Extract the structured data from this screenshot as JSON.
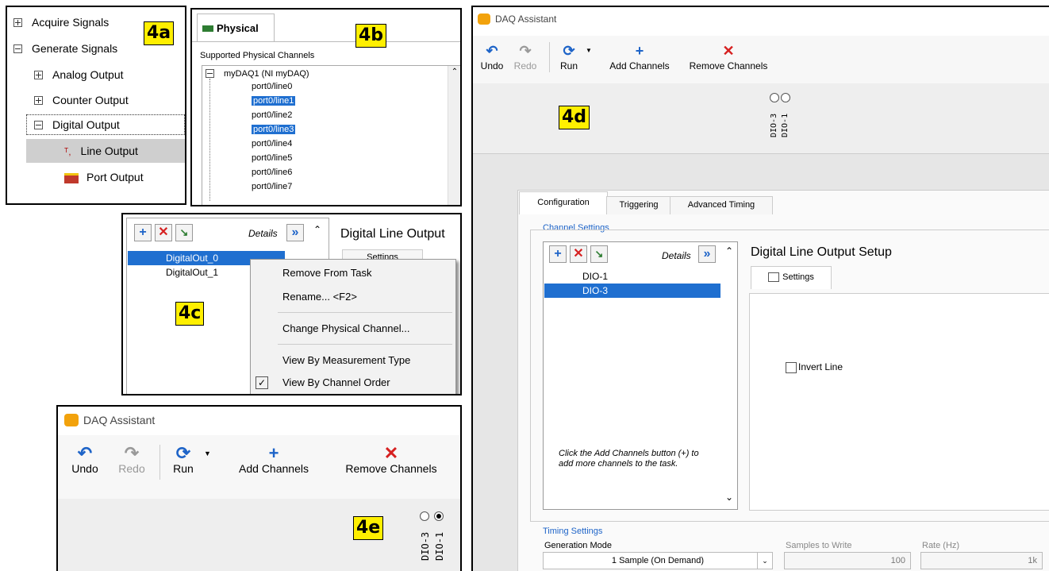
{
  "panel_4a": {
    "tag": "4a",
    "rows": [
      {
        "label": "Acquire Signals",
        "expander": "plus"
      },
      {
        "label": "Generate Signals",
        "expander": "minus"
      },
      {
        "label": "Analog Output",
        "expander": "plus"
      },
      {
        "label": "Counter Output",
        "expander": "plus"
      },
      {
        "label": "Digital Output",
        "expander": "minus"
      },
      {
        "label": "Line Output",
        "icon": "line-output-icon"
      },
      {
        "label": "Port Output",
        "icon": "port-output-icon"
      }
    ]
  },
  "panel_4b": {
    "tag": "4b",
    "tab_label": "Physical",
    "section_label": "Supported Physical Channels",
    "device": "myDAQ1  (NI myDAQ)",
    "channels": [
      "port0/line0",
      "port0/line1",
      "port0/line2",
      "port0/line3",
      "port0/line4",
      "port0/line5",
      "port0/line6",
      "port0/line7"
    ],
    "selected": [
      "port0/line1",
      "port0/line3"
    ]
  },
  "panel_4c": {
    "tag": "4c",
    "details_label": "Details",
    "heading": "Digital Line Output",
    "settings_tab": "Settings",
    "channels": [
      "DigitalOut_0",
      "DigitalOut_1"
    ],
    "context_menu": [
      "Remove From Task",
      "Rename... <F2>",
      "Change Physical Channel...",
      "View By Measurement Type",
      "View By Channel Order"
    ]
  },
  "panel_4d": {
    "tag": "4d",
    "window_title": "DAQ Assistant",
    "toolbar": {
      "undo": "Undo",
      "redo": "Redo",
      "run": "Run",
      "add": "Add Channels",
      "remove": "Remove Channels"
    },
    "leds": [
      "DIO-3",
      "DIO-1"
    ],
    "tabs": [
      "Configuration",
      "Triggering",
      "Advanced Timing"
    ],
    "channel_settings_label": "Channel Settings",
    "details_label": "Details",
    "channels": [
      "DIO-1",
      "DIO-3"
    ],
    "hint": "Click the Add Channels button (+) to add more channels to the task.",
    "setup_heading": "Digital Line Output Setup",
    "settings_tab": "Settings",
    "invert_label": "Invert Line",
    "timing_label": "Timing Settings",
    "generation_mode_label": "Generation Mode",
    "generation_mode_value": "1 Sample (On Demand)",
    "samples_label": "Samples to Write",
    "samples_value": "100",
    "rate_label": "Rate (Hz)",
    "rate_value": "1k"
  },
  "panel_4e": {
    "tag": "4e",
    "window_title": "DAQ Assistant",
    "toolbar": {
      "undo": "Undo",
      "redo": "Redo",
      "run": "Run",
      "add": "Add Channels",
      "remove": "Remove Channels"
    },
    "leds": [
      "DIO-3",
      "DIO-1"
    ]
  },
  "colors": {
    "tag_bg": "#ffef00",
    "selection": "#1f6fd0",
    "undo_blue": "#1e64c8",
    "remove_red": "#d62020"
  }
}
